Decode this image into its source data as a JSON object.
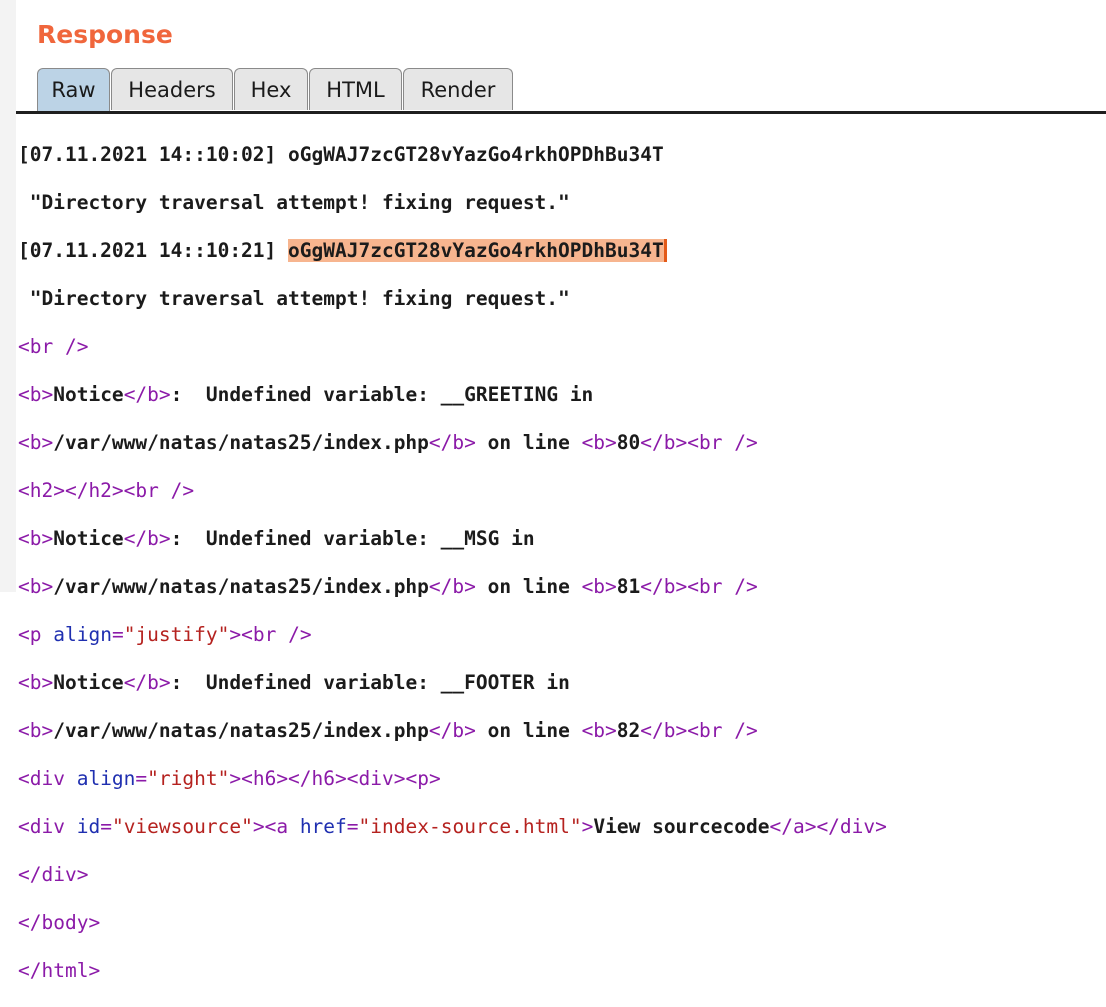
{
  "header": {
    "title": "Response"
  },
  "tabs": [
    {
      "label": "Raw",
      "active": true
    },
    {
      "label": "Headers",
      "active": false
    },
    {
      "label": "Hex",
      "active": false
    },
    {
      "label": "HTML",
      "active": false
    },
    {
      "label": "Render",
      "active": false
    }
  ],
  "content": {
    "log": {
      "entry1_time": "[07.11.2021 14::10:02]",
      "entry1_token": "oGgWAJ7zcGT28vYazGo4rkhOPDhBu34T",
      "entry1_msg": " \"Directory traversal attempt! fixing request.\"",
      "entry2_time": "[07.11.2021 14::10:21]",
      "entry2_token": "oGgWAJ7zcGT28vYazGo4rkhOPDhBu34T",
      "entry2_msg": " \"Directory traversal attempt! fixing request.\""
    },
    "notices": [
      {
        "label": "Notice",
        "message": ":  Undefined variable: __GREETING in",
        "path": "/var/www/natas/natas25/index.php",
        "on_line": " on line ",
        "line": "80"
      },
      {
        "label": "Notice",
        "message": ":  Undefined variable: __MSG in",
        "path": "/var/www/natas/natas25/index.php",
        "on_line": " on line ",
        "line": "81"
      },
      {
        "label": "Notice",
        "message": ":  Undefined variable: __FOOTER in",
        "path": "/var/www/natas/natas25/index.php",
        "on_line": " on line ",
        "line": "82"
      }
    ],
    "p_align": "justify",
    "div_align": "right",
    "div_id": "viewsource",
    "link_href": "index-source.html",
    "link_text": "View sourcecode"
  },
  "colors": {
    "title": "#f0663c",
    "active_tab": "#bcd3e6",
    "tag": "#8b1aa8",
    "attr": "#1f2fb0",
    "value": "#b5221f",
    "selection": "#f7b58f"
  }
}
